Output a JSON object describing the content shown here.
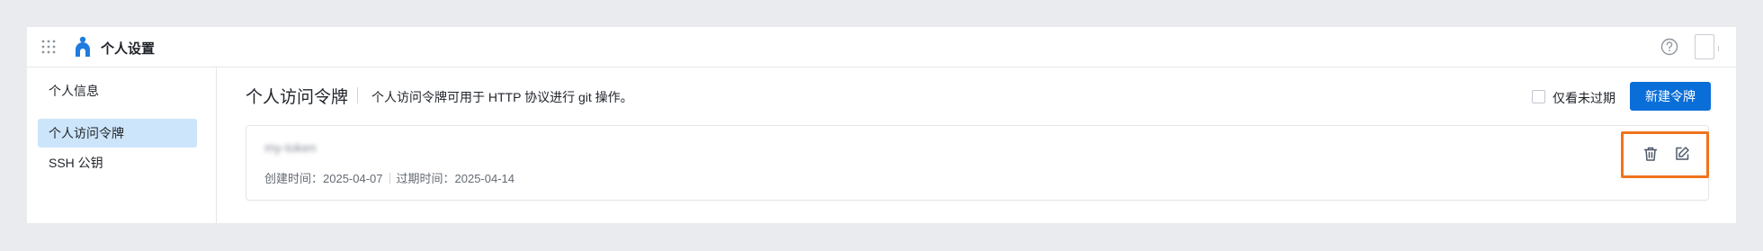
{
  "header": {
    "title": "个人设置",
    "icons": [
      "apps-grid-icon",
      "logo-icon",
      "help-icon",
      "avatar"
    ]
  },
  "sidebar": {
    "items": [
      {
        "label": "个人信息",
        "active": false
      },
      {
        "label": "个人访问令牌",
        "active": true
      },
      {
        "label": "SSH 公钥",
        "active": false
      }
    ]
  },
  "main": {
    "title": "个人访问令牌",
    "description": "个人访问令牌可用于 HTTP 协议进行 git 操作。",
    "filter_label": "仅看未过期",
    "filter_checked": false,
    "new_button_label": "新建令牌"
  },
  "tokens": [
    {
      "name": "my-token",
      "created": "创建时间：2025-04-07",
      "expires": "过期时间：2025-04-14",
      "actions": [
        "delete-icon",
        "edit-icon"
      ]
    }
  ],
  "colors": {
    "primary": "#0a6ed8",
    "active_nav": "#cde5fb",
    "highlight": "#f0731d"
  }
}
